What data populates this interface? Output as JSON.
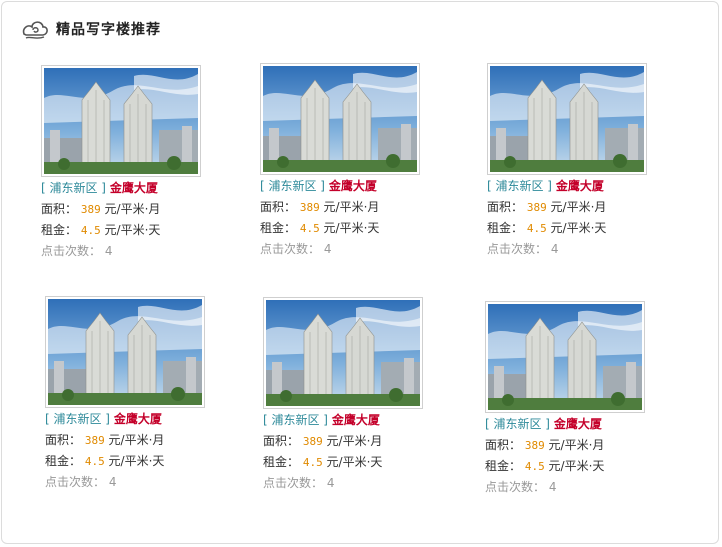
{
  "section": {
    "title": "精品写字楼推荐"
  },
  "listings": [
    {
      "district": "[ 浦东新区 ]",
      "name": "金鹰大厦",
      "area_label": "面积：",
      "area_value": "389",
      "area_unit": "元/平米·月",
      "rent_label": "租金：",
      "rent_value": "4.5",
      "rent_unit": "元/平米·天",
      "clicks_label": "点击次数：",
      "clicks_value": "4"
    },
    {
      "district": "[ 浦东新区 ]",
      "name": "金鹰大厦",
      "area_label": "面积：",
      "area_value": "389",
      "area_unit": "元/平米·月",
      "rent_label": "租金：",
      "rent_value": "4.5",
      "rent_unit": "元/平米·天",
      "clicks_label": "点击次数：",
      "clicks_value": "4"
    },
    {
      "district": "[ 浦东新区 ]",
      "name": "金鹰大厦",
      "area_label": "面积：",
      "area_value": "389",
      "area_unit": "元/平米·月",
      "rent_label": "租金：",
      "rent_value": "4.5",
      "rent_unit": "元/平米·天",
      "clicks_label": "点击次数：",
      "clicks_value": "4"
    },
    {
      "district": "[ 浦东新区 ]",
      "name": "金鹰大厦",
      "area_label": "面积：",
      "area_value": "389",
      "area_unit": "元/平米·月",
      "rent_label": "租金：",
      "rent_value": "4.5",
      "rent_unit": "元/平米·天",
      "clicks_label": "点击次数：",
      "clicks_value": "4"
    },
    {
      "district": "[ 浦东新区 ]",
      "name": "金鹰大厦",
      "area_label": "面积：",
      "area_value": "389",
      "area_unit": "元/平米·月",
      "rent_label": "租金：",
      "rent_value": "4.5",
      "rent_unit": "元/平米·天",
      "clicks_label": "点击次数：",
      "clicks_value": "4"
    },
    {
      "district": "[ 浦东新区 ]",
      "name": "金鹰大厦",
      "area_label": "面积：",
      "area_value": "389",
      "area_unit": "元/平米·月",
      "rent_label": "租金：",
      "rent_value": "4.5",
      "rent_unit": "元/平米·天",
      "clicks_label": "点击次数：",
      "clicks_value": "4"
    }
  ],
  "icons": {
    "header": "cloud-swirl-icon"
  },
  "colors": {
    "district": "#2e8a9a",
    "name": "#c4002a",
    "value": "#e08a00",
    "muted": "#999999"
  }
}
